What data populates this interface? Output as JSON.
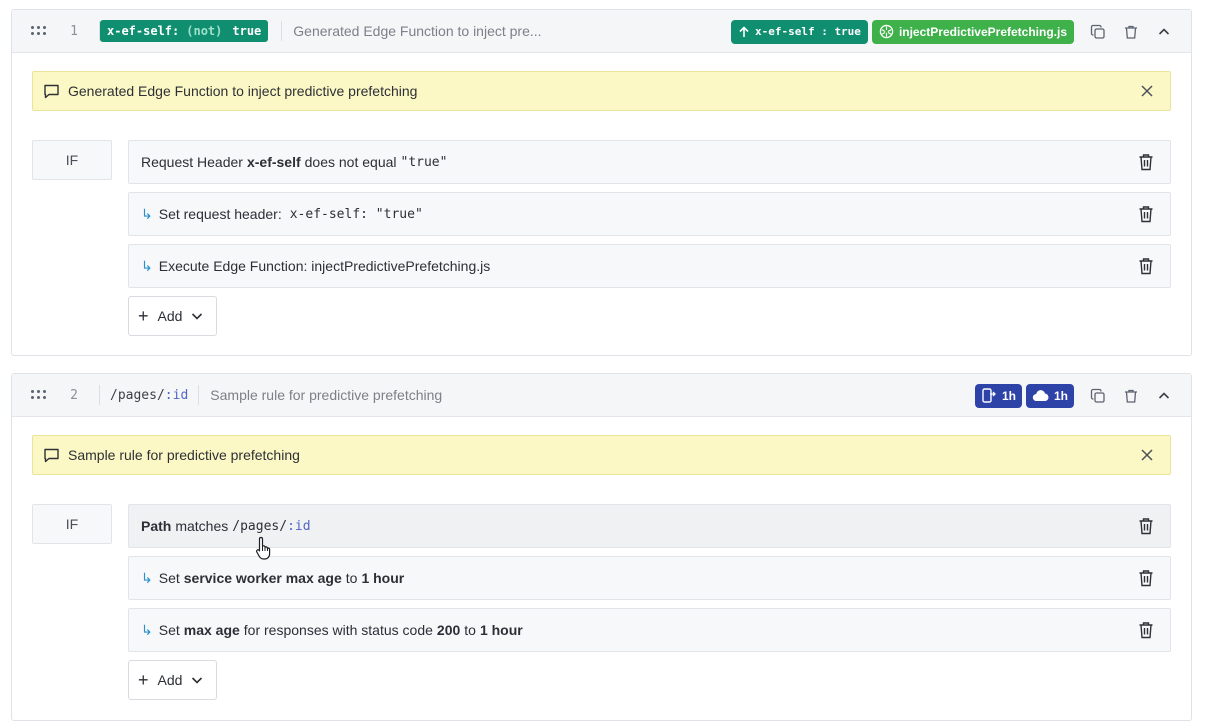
{
  "rules": [
    {
      "number": "1",
      "condition_chip": {
        "key": "x-ef-self:",
        "not": "(not)",
        "value": "true"
      },
      "header_description": "Generated Edge Function to inject pre...",
      "badges": {
        "header_badge": "x-ef-self : true",
        "function_badge": "injectPredictivePrefetching.js"
      },
      "note": "Generated Edge Function to inject predictive prefetching",
      "if_label": "IF",
      "condition": {
        "subject": "Request Header",
        "name": "x-ef-self",
        "operator": "does not equal",
        "value": "\"true\""
      },
      "actions": [
        {
          "prefix": "Set request header:",
          "code": "x-ef-self: \"true\""
        },
        {
          "text": "Execute Edge Function: injectPredictivePrefetching.js"
        }
      ],
      "add_label": "Add"
    },
    {
      "number": "2",
      "path": "/pages/",
      "path_var": ":id",
      "header_description": "Sample rule for predictive prefetching",
      "badges": {
        "device_cache": "1h",
        "edge_cache": "1h"
      },
      "note": "Sample rule for predictive prefetching",
      "if_label": "IF",
      "condition": {
        "subject": "Path",
        "operator": "matches",
        "path": "/pages/",
        "path_var": ":id"
      },
      "actions": [
        {
          "set": "Set",
          "name": "service worker max age",
          "to": "to",
          "value": "1 hour"
        },
        {
          "set": "Set",
          "name": "max age",
          "middle": "for responses with status code",
          "code": "200",
          "to": "to",
          "value": "1 hour"
        }
      ],
      "add_label": "Add"
    }
  ],
  "colors": {
    "teal_badge": "#0f8e70",
    "green_badge": "#3fb14a",
    "blue_badge": "#2e43a8",
    "note_bg": "#fcf8c5",
    "arrow": "#2a8fd0"
  }
}
